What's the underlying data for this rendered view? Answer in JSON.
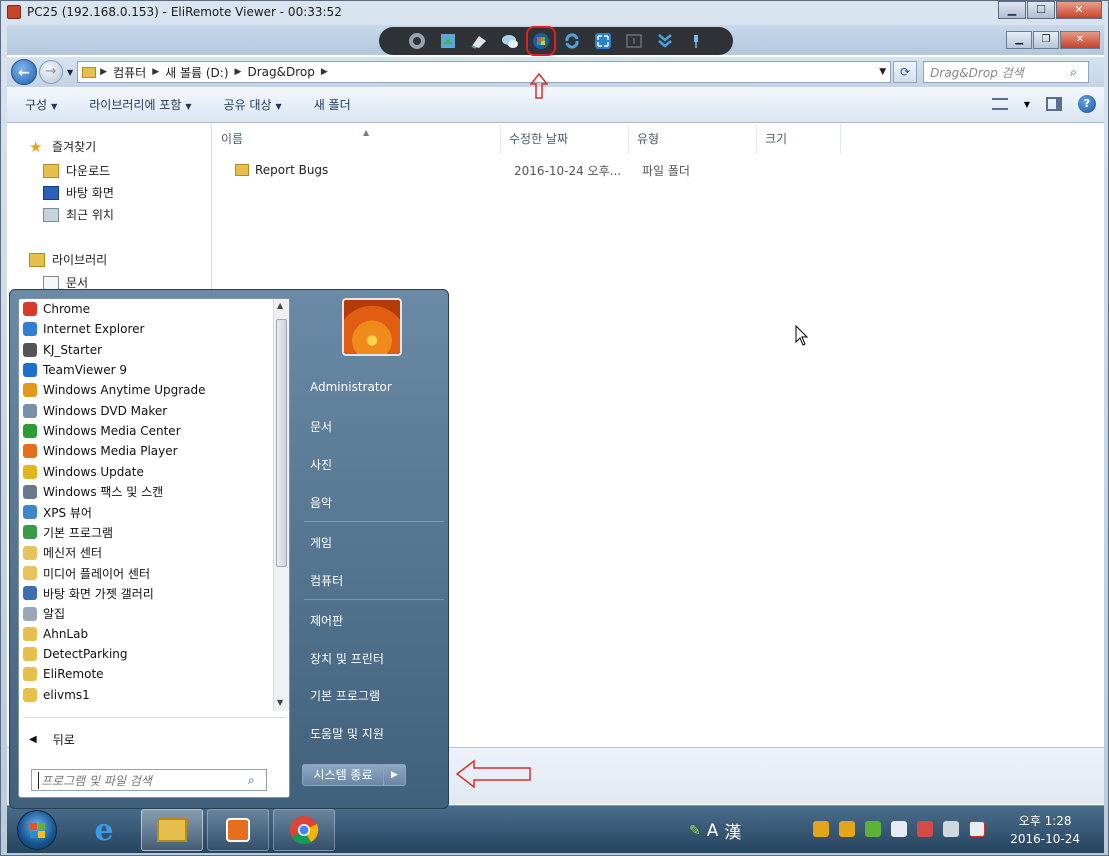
{
  "viewer": {
    "title": "PC25 (192.168.0.153) - EliRemote Viewer - 00:33:52",
    "minimize_label": "▁",
    "maximize_label": "☐",
    "close_label": "✕"
  },
  "explorer": {
    "minimize_label": "▁",
    "restore_label": "❐",
    "close_label": "✕",
    "breadcrumbs": [
      "컴퓨터",
      "새 볼륨 (D:)",
      "Drag&Drop"
    ],
    "search_placeholder": "Drag&Drop 검색",
    "commands": [
      "구성",
      "라이브러리에 포함",
      "공유 대상",
      "새 폴더"
    ],
    "nav": {
      "favorites": "즐겨찾기",
      "downloads": "다운로드",
      "desktop": "바탕 화면",
      "recent": "최근 위치",
      "libraries": "라이브러리",
      "documents": "문서"
    },
    "columns": [
      "이름",
      "수정한 날짜",
      "유형",
      "크기"
    ],
    "files": [
      {
        "name": "Report Bugs",
        "modified": "2016-10-24 오후...",
        "type": "파일 폴더",
        "size": ""
      }
    ]
  },
  "start_menu": {
    "programs": [
      {
        "label": "Chrome",
        "icon": "chrome-icon",
        "color": "#d9392b"
      },
      {
        "label": "Internet Explorer",
        "icon": "internet-explorer-icon",
        "color": "#2f7fd3"
      },
      {
        "label": "KJ_Starter",
        "icon": "kj-starter-icon",
        "color": "#555555"
      },
      {
        "label": "TeamViewer 9",
        "icon": "teamviewer-icon",
        "color": "#1a6fd1"
      },
      {
        "label": "Windows Anytime Upgrade",
        "icon": "windows-anytime-upgrade-icon",
        "color": "#e39a1c"
      },
      {
        "label": "Windows DVD Maker",
        "icon": "dvd-maker-icon",
        "color": "#7a8fa8"
      },
      {
        "label": "Windows Media Center",
        "icon": "media-center-icon",
        "color": "#2f9a3a"
      },
      {
        "label": "Windows Media Player",
        "icon": "media-player-icon",
        "color": "#e4701e"
      },
      {
        "label": "Windows Update",
        "icon": "windows-update-icon",
        "color": "#e3b51c"
      },
      {
        "label": "Windows 팩스 및 스캔",
        "icon": "fax-scan-icon",
        "color": "#6a7a8c"
      },
      {
        "label": "XPS 뷰어",
        "icon": "xps-viewer-icon",
        "color": "#3d87c9"
      },
      {
        "label": "기본 프로그램",
        "icon": "default-programs-icon",
        "color": "#3a9a48"
      },
      {
        "label": "메신저 센터",
        "icon": "messenger-center-icon",
        "color": "#e7c35a"
      },
      {
        "label": "미디어 플레이어 센터",
        "icon": "media-player-center-icon",
        "color": "#e7c35a"
      },
      {
        "label": "바탕 화면 가젯 갤러리",
        "icon": "gadget-gallery-icon",
        "color": "#3d6fb0"
      },
      {
        "label": "알집",
        "icon": "alzip-icon",
        "color": "#9aa7b5"
      },
      {
        "label": "AhnLab",
        "icon": "folder-icon",
        "color": "#e6bf4c"
      },
      {
        "label": "DetectParking",
        "icon": "folder-icon",
        "color": "#e6bf4c"
      },
      {
        "label": "EliRemote",
        "icon": "folder-icon",
        "color": "#e6bf4c"
      },
      {
        "label": "elivms1",
        "icon": "folder-icon",
        "color": "#e6bf4c"
      }
    ],
    "back_label": "뒤로",
    "search_placeholder": "프로그램 및 파일 검색",
    "user_name": "Administrator",
    "right_links": [
      "문서",
      "사진",
      "음악",
      "게임",
      "컴퓨터",
      "제어판",
      "장치 및 프린터",
      "기본 프로그램",
      "도움말 및 지원"
    ],
    "shutdown_label": "시스템 종료"
  },
  "taskbar": {
    "ime_a": "A",
    "ime_han": "漢",
    "clock_time": "오후 1:28",
    "clock_date": "2016-10-24"
  },
  "colors": {
    "toolbar_bg": "#2f3337",
    "highlight_red": "#e02020",
    "taskbar_bg": "#27445f"
  }
}
